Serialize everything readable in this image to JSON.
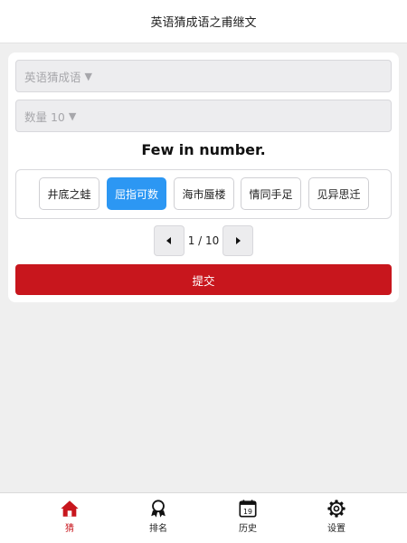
{
  "app": {
    "title": "英语猜成语之甫继文"
  },
  "filters": {
    "category": {
      "value": "英语猜成语",
      "arrow": "▼"
    },
    "count": {
      "value": "数量 10",
      "arrow": "▼"
    }
  },
  "question": {
    "text": "Few in number."
  },
  "options": [
    {
      "label": "井底之蛙",
      "selected": false
    },
    {
      "label": "屈指可数",
      "selected": true
    },
    {
      "label": "海市蜃楼",
      "selected": false
    },
    {
      "label": "情同手足",
      "selected": false
    },
    {
      "label": "见异思迁",
      "selected": false
    }
  ],
  "pager": {
    "current": 1,
    "total": 10,
    "text": "1 / 10"
  },
  "submit": {
    "label": "提交"
  },
  "tabs": [
    {
      "label": "猜",
      "icon": "home-icon",
      "active": true
    },
    {
      "label": "排名",
      "icon": "award-icon",
      "active": false
    },
    {
      "label": "历史",
      "icon": "calendar-icon",
      "active": false,
      "icon_text": "19"
    },
    {
      "label": "设置",
      "icon": "gear-icon",
      "active": false
    }
  ],
  "colors": {
    "accent_red": "#c8161d",
    "selected_blue": "#2c97f3"
  }
}
